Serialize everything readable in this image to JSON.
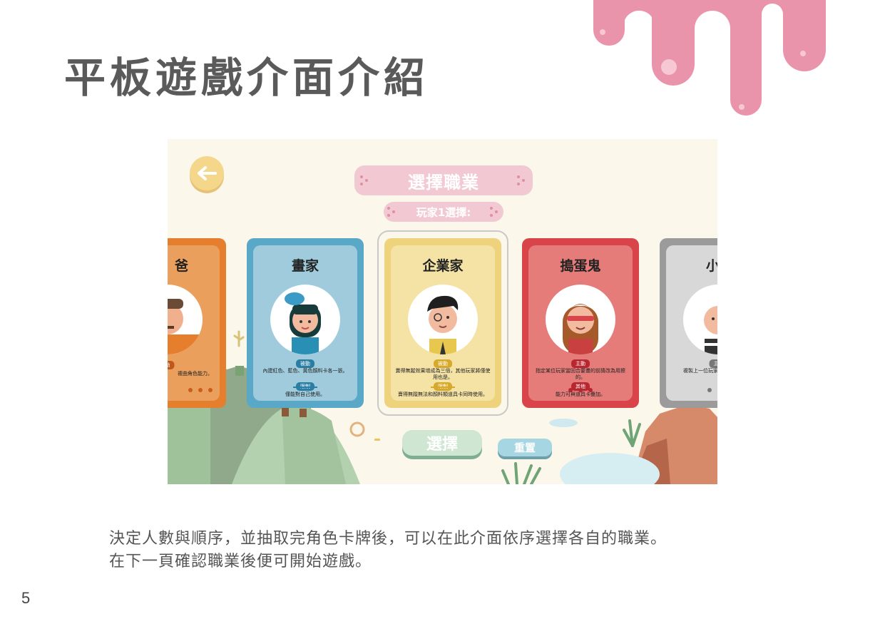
{
  "page": {
    "title": "平板遊戲介面介紹",
    "page_number": "5"
  },
  "caption": {
    "line1": "決定人數與順序，並抽取完角色卡牌後，可以在此介面依序選擇各自的職業。",
    "line2": "在下一頁確認職業後便可開始遊戲。"
  },
  "screen": {
    "banner": "選擇職業",
    "subbanner": "玩家1選擇:",
    "select_button": "選擇",
    "reset_button": "重置",
    "cards": [
      {
        "name": "爸",
        "tag1": "動",
        "desc1": "複曲角色能力。",
        "tag2": "",
        "desc2": ""
      },
      {
        "name": "畫家",
        "tag1": "被動",
        "desc1": "內建紅色、藍色、黃色顏料卡各一張。",
        "tag2": "限制",
        "desc2": "僅能對自己使用。"
      },
      {
        "name": "企業家",
        "tag1": "被動",
        "desc1": "賣得無蹤效果增成為三倍，其他玩家將僅使用也是。",
        "tag2": "限制",
        "desc2": "賣得無蹤無法和顏料類道具卡同時使用。"
      },
      {
        "name": "搗蛋鬼",
        "tag1": "主動",
        "desc1": "指定某位玩家當回合要畫的前猜改為用擦的。",
        "tag2": "其他",
        "desc2": "能力可與道具卡疊加。"
      },
      {
        "name": "小",
        "tag1": "主",
        "desc1": "複製上一位玩家",
        "tag2": "",
        "desc2": ""
      }
    ]
  },
  "colors": {
    "title": "#5a5a5a",
    "accent_pink": "#f2c9d2",
    "drip_pink": "#ea94ac"
  }
}
